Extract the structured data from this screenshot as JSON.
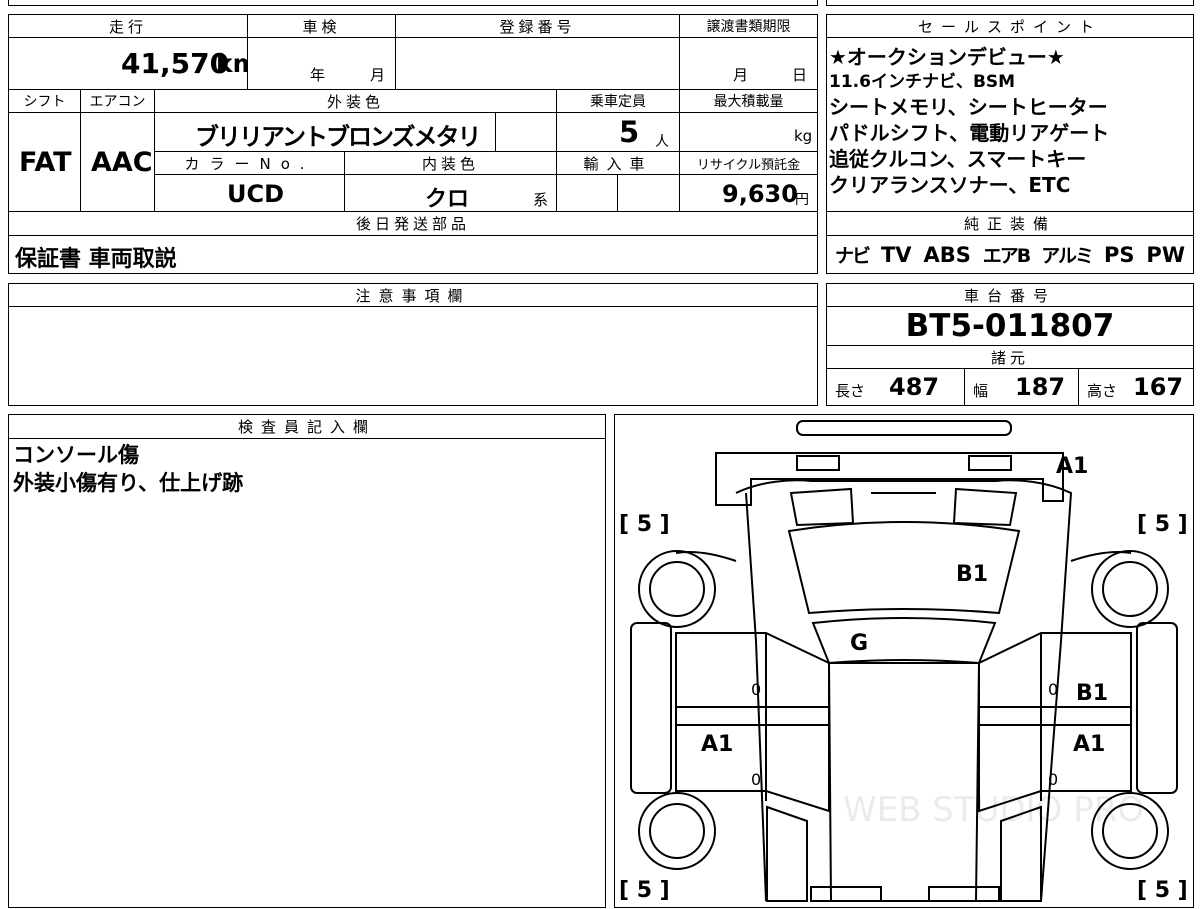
{
  "top_row": {
    "mileage_label": "走行",
    "inspection_label": "車検",
    "registration_label": "登録番号",
    "transfer_deadline_label": "譲渡書類期限",
    "mileage_value": "41,570",
    "mileage_unit": "km",
    "year_unit": "年",
    "month_unit": "月",
    "deadline_month_unit": "月",
    "deadline_day_unit": "日"
  },
  "second_row": {
    "shift_label": "シフト",
    "ac_label": "エアコン",
    "exterior_color_label": "外装色",
    "capacity_label": "乗車定員",
    "max_load_label": "最大積載量",
    "shift_value": "FAT",
    "ac_value": "AAC",
    "exterior_color_value": "ブリリアントブロンズメタリ",
    "capacity_value": "5",
    "capacity_unit": "人",
    "load_unit": "kg",
    "color_no_label": "カラーNo.",
    "interior_color_label": "内装色",
    "import_label": "輸入車",
    "recycle_label": "リサイクル預託金",
    "color_no_value": "UCD",
    "interior_color_value": "クロ",
    "interior_suffix": "系",
    "recycle_value": "9,630",
    "recycle_unit": "円"
  },
  "later_parts": {
    "label": "後日発送部品",
    "value": "保証書 車両取説"
  },
  "sales_points": {
    "label": "セールスポイント",
    "lines": [
      "★オークションデビュー★",
      "11.6インチナビ、BSM",
      "シートメモリ、シートヒーター",
      "パドルシフト、電動リアゲート",
      "追従クルコン、スマートキー",
      "クリアランスソナー、ETC"
    ]
  },
  "standard_equipment": {
    "label": "純正装備",
    "items": [
      "ナビ",
      "TV",
      "ABS",
      "エアB",
      "アルミ",
      "PS",
      "PW"
    ]
  },
  "notes": {
    "label": "注意事項欄",
    "value": ""
  },
  "chassis": {
    "label": "車台番号",
    "value": "BT5-011807"
  },
  "specs": {
    "label": "諸元",
    "length_label": "長さ",
    "length_value": "487",
    "width_label": "幅",
    "width_value": "187",
    "height_label": "高さ",
    "height_value": "167"
  },
  "inspector": {
    "label": "検査員記入欄",
    "lines": [
      "コンソール傷",
      "外装小傷有り、仕上げ跡"
    ]
  },
  "diagram": {
    "tire_tl": "[ 5 ]",
    "tire_tr": "[ 5 ]",
    "tire_bl": "[ 5 ]",
    "tire_br": "[ 5 ]",
    "rear_bumper": "A1",
    "rear_glass": "B1",
    "roof_glass": "G",
    "left_rear_door_value": "0",
    "right_rear_door_value": "0",
    "right_rear_door": "B1",
    "left_front_door": "A1",
    "right_front_door": "A1",
    "left_front_door_value": "0",
    "right_front_door_value": "0",
    "watermark": "WEB STUDIO PRO"
  }
}
